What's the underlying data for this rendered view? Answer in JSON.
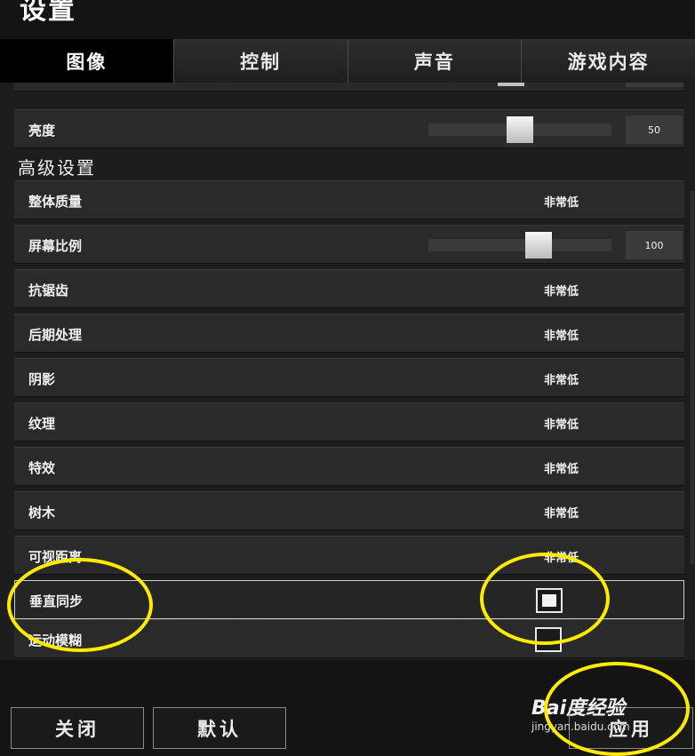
{
  "header": {
    "title": "设置"
  },
  "tabs": [
    {
      "label": "图像",
      "active": true
    },
    {
      "label": "控制",
      "active": false
    },
    {
      "label": "声音",
      "active": false
    },
    {
      "label": "游戏内容",
      "active": false
    }
  ],
  "settings": {
    "brightness": {
      "label": "亮度",
      "value": "50",
      "level": 0.5
    },
    "advanced_heading": "高级设置",
    "overall_quality": {
      "label": "整体质量",
      "value": "非常低"
    },
    "screen_scale": {
      "label": "屏幕比例",
      "value": "100",
      "level": 0.6
    },
    "anti_aliasing": {
      "label": "抗锯齿",
      "value": "非常低"
    },
    "post_processing": {
      "label": "后期处理",
      "value": "非常低"
    },
    "shadows": {
      "label": "阴影",
      "value": "非常低"
    },
    "textures": {
      "label": "纹理",
      "value": "非常低"
    },
    "effects": {
      "label": "特效",
      "value": "非常低"
    },
    "foliage": {
      "label": "树木",
      "value": "非常低"
    },
    "view_distance": {
      "label": "可视距离",
      "value": "非常低"
    },
    "vsync": {
      "label": "垂直同步",
      "checked": true
    },
    "motion_blur": {
      "label": "运动模糊",
      "checked": false
    }
  },
  "footer": {
    "close_label": "关闭",
    "default_label": "默认",
    "apply_label": "应用"
  },
  "watermark": {
    "brand": "Bai度经验",
    "site": "jingyan.baidu.com"
  },
  "colors": {
    "annotation": "#ffeb00",
    "background": "#1a1a1a",
    "row": "#2a2a2a"
  }
}
